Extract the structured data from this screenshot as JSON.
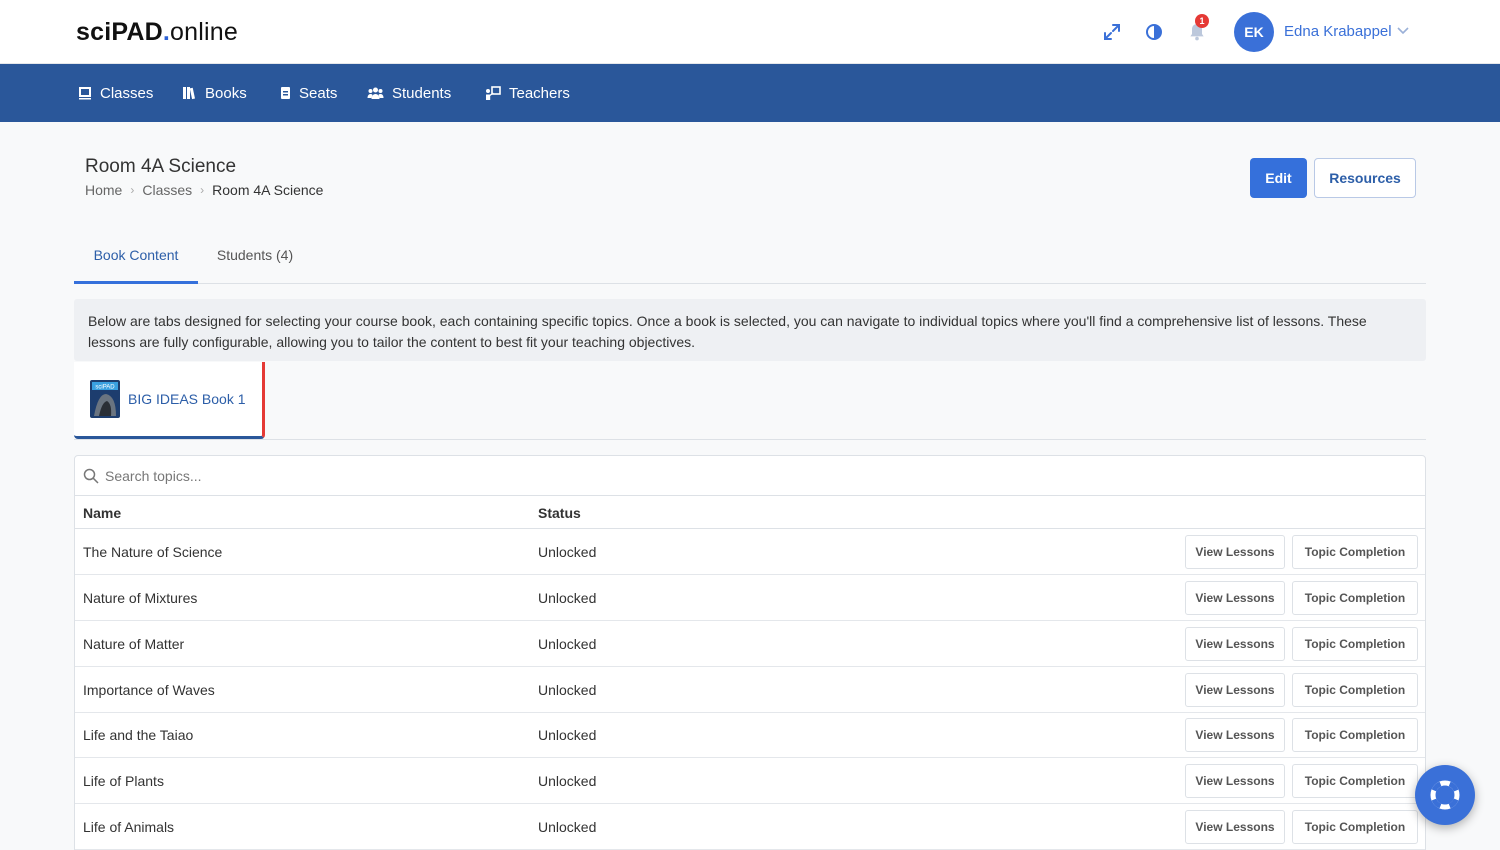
{
  "header": {
    "logo_bold": "sciPAD",
    "logo_dot": ".",
    "logo_rest": "online",
    "notification_count": "1",
    "user_initials": "EK",
    "user_name": "Edna Krabappel",
    "icons": [
      "fullscreen-icon",
      "contrast-icon",
      "bell-icon",
      "chevron-down-icon"
    ]
  },
  "nav": {
    "items": [
      {
        "label": "Classes",
        "icon": "classes-icon"
      },
      {
        "label": "Books",
        "icon": "books-icon"
      },
      {
        "label": "Seats",
        "icon": "seats-icon"
      },
      {
        "label": "Students",
        "icon": "students-icon"
      },
      {
        "label": "Teachers",
        "icon": "teachers-icon"
      }
    ]
  },
  "page": {
    "title": "Room 4A Science",
    "breadcrumb": [
      "Home",
      "Classes",
      "Room 4A Science"
    ],
    "edit_label": "Edit",
    "resources_label": "Resources"
  },
  "tabs": [
    {
      "label": "Book Content",
      "active": true
    },
    {
      "label": "Students (4)",
      "active": false
    }
  ],
  "info_text": "Below are tabs designed for selecting your course book, each containing specific topics. Once a book is selected, you can navigate to individual topics where you'll find a comprehensive list of lessons. These lessons are fully configurable, allowing you to tailor the content to best fit your teaching objectives.",
  "book": {
    "label": "BIG IDEAS Book 1"
  },
  "table": {
    "search_placeholder": "Search topics...",
    "columns": [
      "Name",
      "Status"
    ],
    "view_label": "View Lessons",
    "completion_label": "Topic Completion",
    "rows": [
      {
        "name": "The Nature of Science",
        "status": "Unlocked"
      },
      {
        "name": "Nature of Mixtures",
        "status": "Unlocked"
      },
      {
        "name": "Nature of Matter",
        "status": "Unlocked"
      },
      {
        "name": "Importance of Waves",
        "status": "Unlocked"
      },
      {
        "name": "Life and the Taiao",
        "status": "Unlocked"
      },
      {
        "name": "Life of Plants",
        "status": "Unlocked"
      },
      {
        "name": "Life of Animals",
        "status": "Unlocked"
      }
    ]
  },
  "colors": {
    "nav_bg": "#2a579a",
    "primary": "#3570db",
    "link": "#2c5ea8",
    "badge": "#e53935"
  }
}
